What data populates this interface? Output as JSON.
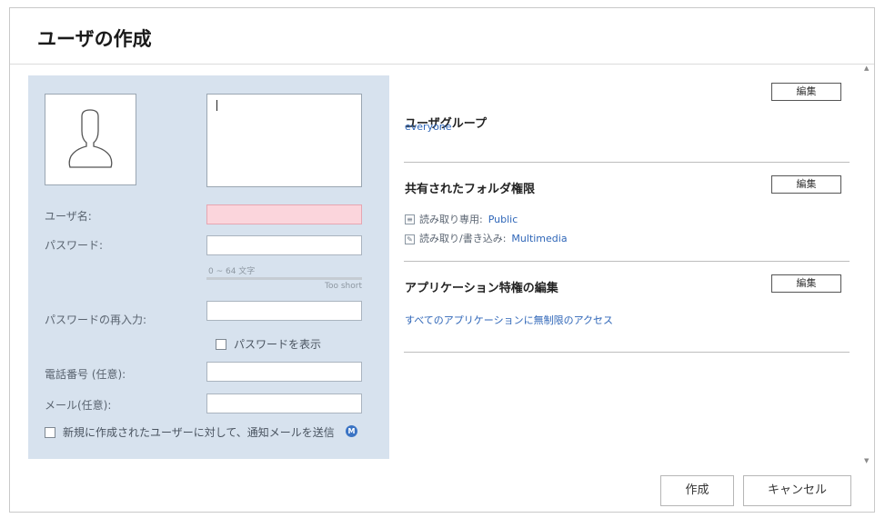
{
  "dialog": {
    "title": "ユーザの作成"
  },
  "form": {
    "username_label": "ユーザ名:",
    "password_label": "パスワード:",
    "password_hint": "0 ~ 64 文字",
    "password_strength": "Too short",
    "password_confirm_label": "パスワードの再入力:",
    "show_password_label": "パスワードを表示",
    "phone_label": "電話番号 (任意):",
    "email_label": "メール(任意):",
    "notify_label": "新規に作成されたユーザーに対して、通知メールを送信",
    "notify_badge": "M"
  },
  "user_group": {
    "title": "ユーザグループ",
    "edit_label": "編集",
    "value": "everyone"
  },
  "shared_folder": {
    "title": "共有されたフォルダ権限",
    "edit_label": "編集",
    "read_only_label": "読み取り専用:",
    "read_only_value": "Public",
    "read_write_label": "読み取り/書き込み:",
    "read_write_value": "Multimedia"
  },
  "app_privilege": {
    "title": "アプリケーション特権の編集",
    "edit_label": "編集",
    "value": "すべてのアプリケーションに無制限のアクセス"
  },
  "actions": {
    "create": "作成",
    "cancel": "キャンセル"
  }
}
